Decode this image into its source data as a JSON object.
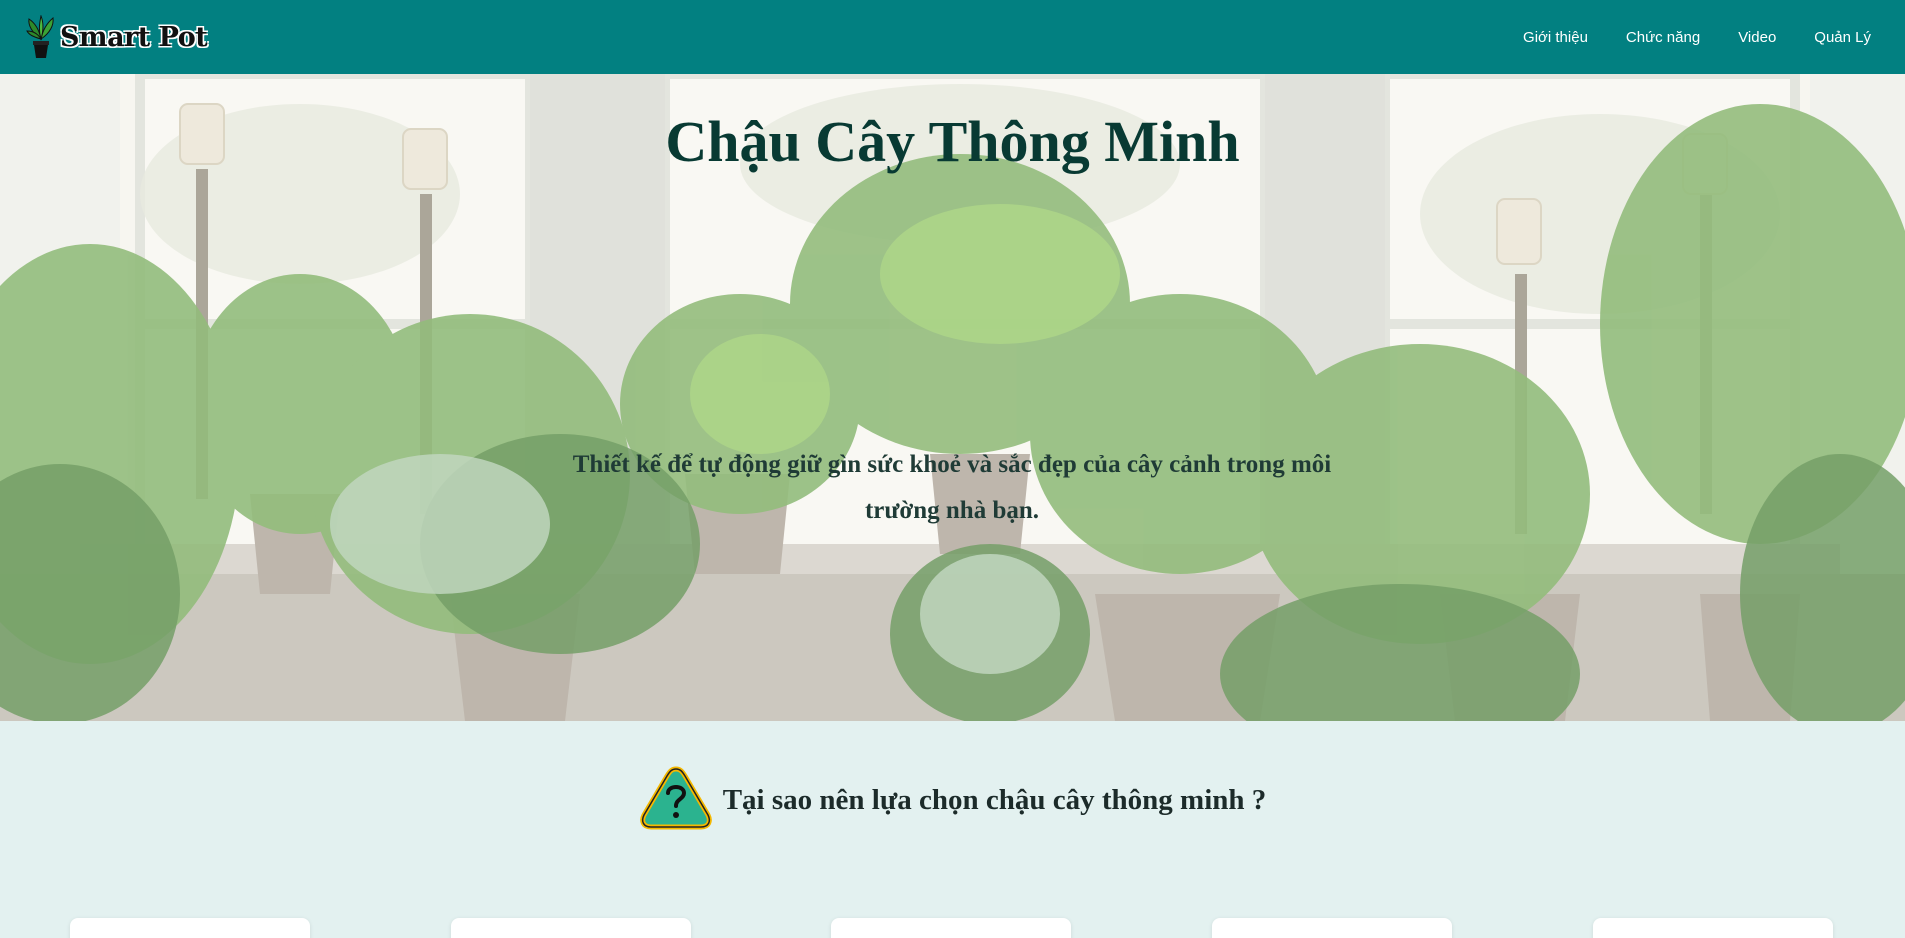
{
  "brand": {
    "name": "Smart Pot",
    "icon": "potted-plant-icon"
  },
  "nav": {
    "items": [
      {
        "label": "Giới thiệu"
      },
      {
        "label": "Chức năng"
      },
      {
        "label": "Video"
      },
      {
        "label": "Quản Lý"
      }
    ]
  },
  "hero": {
    "title": "Chậu Cây Thông Minh",
    "subtitle": "Thiết kế để tự động giữ gìn sức khoẻ và sắc đẹp của cây cảnh trong môi trường nhà bạn."
  },
  "why": {
    "icon": "question-warning-icon",
    "title": "Tại sao nên lựa chọn chậu cây thông minh ?"
  },
  "colors": {
    "navbar": "#028081",
    "section_bg": "#e3f1f0",
    "title": "#083a33",
    "icon_fill": "#2bb38f",
    "icon_border": "#f5b800"
  }
}
